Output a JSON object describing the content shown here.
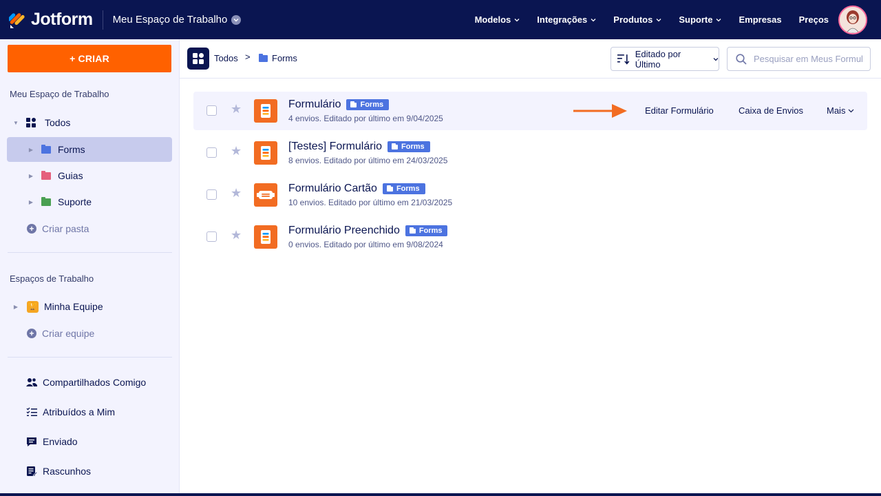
{
  "topbar": {
    "brand": "Jotform",
    "workspace": "Meu Espaço de Trabalho",
    "nav": [
      {
        "label": "Modelos",
        "has_menu": true
      },
      {
        "label": "Integrações",
        "has_menu": true
      },
      {
        "label": "Produtos",
        "has_menu": true
      },
      {
        "label": "Suporte",
        "has_menu": true
      },
      {
        "label": "Empresas",
        "has_menu": false
      },
      {
        "label": "Preços",
        "has_menu": false
      }
    ]
  },
  "sidebar": {
    "create_label": "+ CRIAR",
    "my_workspace_title": "Meu Espaço de Trabalho",
    "all_label": "Todos",
    "folders": [
      {
        "label": "Forms",
        "color": "#4c73e0",
        "selected": true
      },
      {
        "label": "Guias",
        "color": "#e5607c",
        "selected": false
      },
      {
        "label": "Suporte",
        "color": "#4aa052",
        "selected": false
      }
    ],
    "create_folder": "Criar pasta",
    "workspaces_title": "Espaços de Trabalho",
    "team": "Minha Equipe",
    "create_team": "Criar equipe",
    "bottom_items": [
      {
        "label": "Compartilhados Comigo",
        "icon": "shared-users-icon"
      },
      {
        "label": "Atribuídos a Mim",
        "icon": "checklist-icon"
      },
      {
        "label": "Enviado",
        "icon": "sent-message-icon"
      },
      {
        "label": "Rascunhos",
        "icon": "drafts-icon"
      }
    ]
  },
  "toolbar": {
    "breadcrumb_root": "Todos",
    "breadcrumb_separator": ">",
    "breadcrumb_current": "Forms",
    "sort_label": "Editado por Último",
    "search_placeholder": "Pesquisar em Meus Formul..."
  },
  "forms": [
    {
      "title": "Formulário",
      "badge": "Forms",
      "meta": "4 envios. Editado por último em 9/04/2025",
      "icon": "form-list-icon",
      "hovered": true
    },
    {
      "title": "[Testes] Formulário",
      "badge": "Forms",
      "meta": "8 envios. Editado por último em 24/03/2025",
      "icon": "form-list-icon",
      "hovered": false
    },
    {
      "title": "Formulário Cartão",
      "badge": "Forms",
      "meta": "10 envios. Editado por último em 21/03/2025",
      "icon": "card-form-icon",
      "hovered": false
    },
    {
      "title": "Formulário Preenchido",
      "badge": "Forms",
      "meta": "0 envios. Editado por último em 9/08/2024",
      "icon": "form-list-icon",
      "hovered": false
    }
  ],
  "row_actions": {
    "edit": "Editar Formulário",
    "inbox": "Caixa de Envios",
    "more": "Mais"
  },
  "colors": {
    "navy": "#0a1551",
    "orange": "#ff6100",
    "badge_blue": "#4c73e0",
    "sidebar_bg": "#f3f3fe",
    "selected_bg": "#c7cbed"
  }
}
